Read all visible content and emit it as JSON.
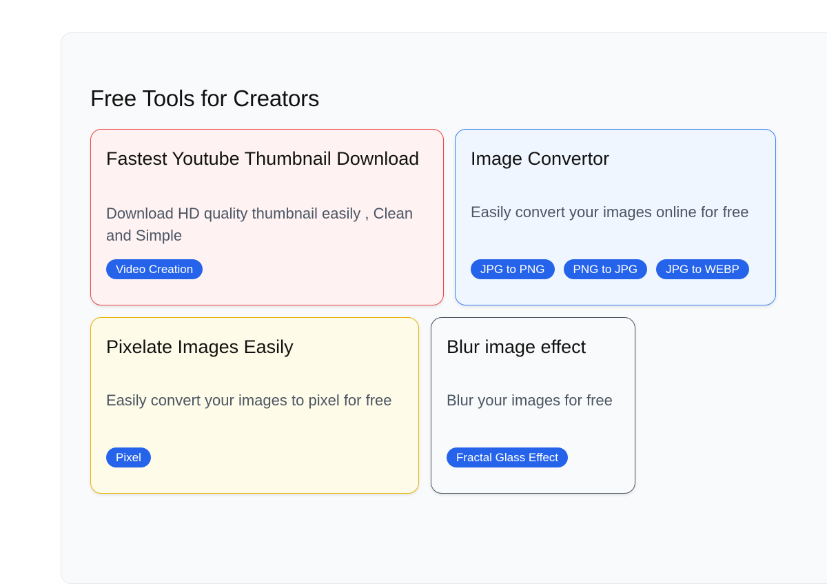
{
  "section": {
    "title": "Free Tools for Creators"
  },
  "cards": [
    {
      "title": "Fastest Youtube Thumbnail Download",
      "description": "Download HD quality thumbnail easily , Clean and Simple",
      "tags": [
        "Video Creation"
      ],
      "accent": "#ef4444",
      "background": "#fef2f2"
    },
    {
      "title": "Image Convertor",
      "description": "Easily convert your images online for free",
      "tags": [
        "JPG to PNG",
        "PNG to JPG",
        "JPG to WEBP"
      ],
      "accent": "#3b82f6",
      "background": "#eff6ff"
    },
    {
      "title": "Pixelate Images Easily",
      "description": "Easily convert your images to pixel for free",
      "tags": [
        "Pixel"
      ],
      "accent": "#eab308",
      "background": "#fefce8"
    },
    {
      "title": "Blur image effect",
      "description": "Blur your images for free",
      "tags": [
        "Fractal Glass Effect"
      ],
      "accent": "#4b5563",
      "background": "#f9fafb"
    }
  ],
  "colors": {
    "tag_background": "#2563eb",
    "tag_text": "#ffffff"
  }
}
